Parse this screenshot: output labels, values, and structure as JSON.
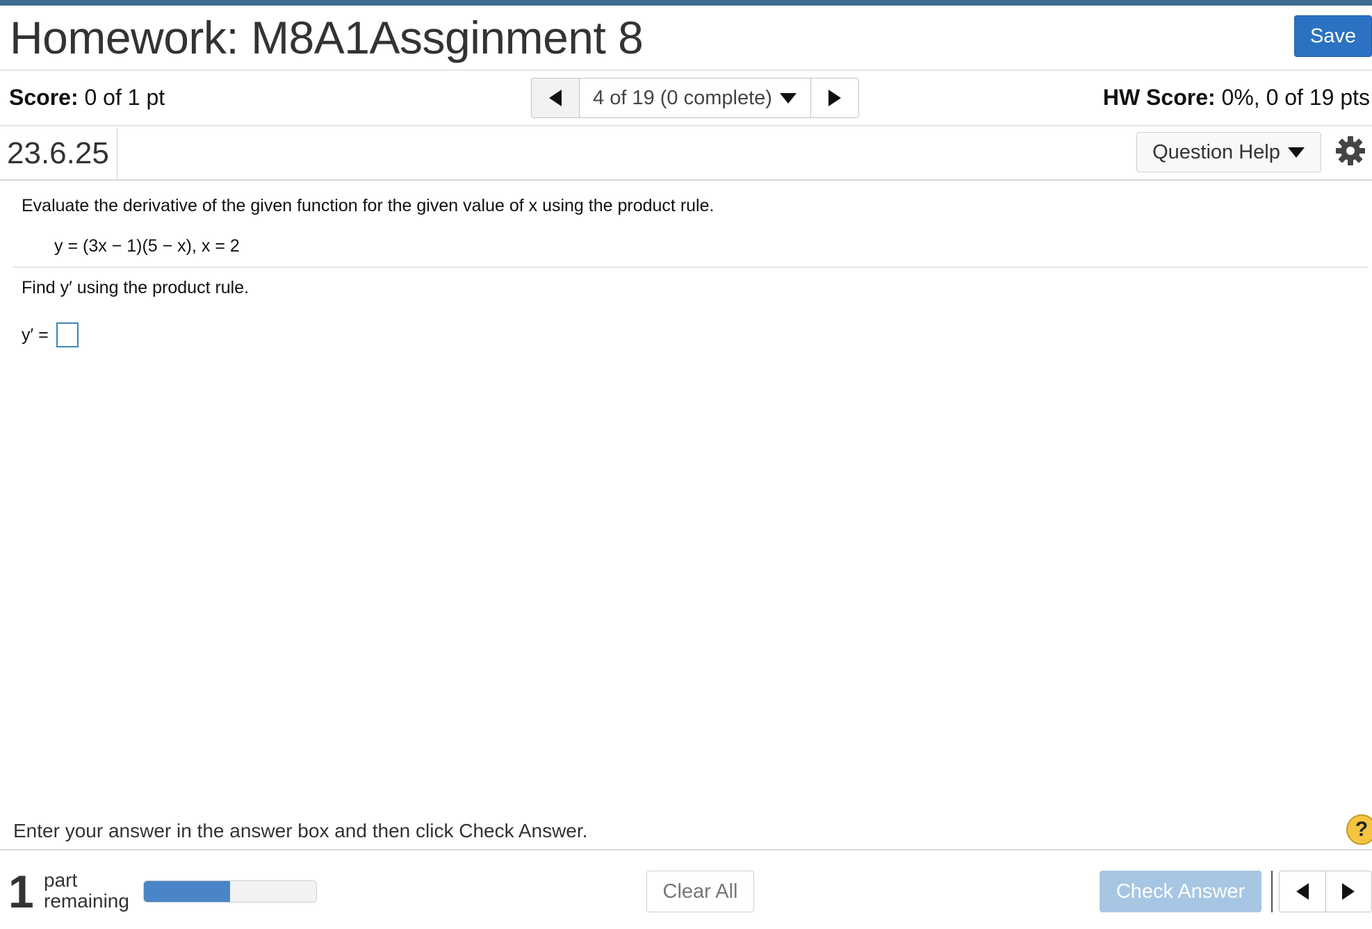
{
  "header": {
    "title": "Homework: M8A1Assginment 8",
    "save_label": "Save"
  },
  "score_bar": {
    "score_label": "Score:",
    "score_value": " 0 of 1 pt",
    "nav_text": "4 of 19 (0 complete)",
    "hw_score_label": "HW Score:",
    "hw_score_value": " 0%, 0 of 19 pts"
  },
  "question_bar": {
    "question_id": "23.6.25",
    "help_label": "Question Help"
  },
  "question": {
    "prompt": "Evaluate the derivative of the given function for the given value of x using the product rule.",
    "equation": "y = (3x − 1)(5 − x), x = 2",
    "find_text": "Find y′ using the product rule.",
    "answer_label": "y′ =",
    "answer_value": ""
  },
  "footer": {
    "instructions": "Enter your answer in the answer box and then click Check Answer.",
    "help_glyph": "?",
    "parts_count": "1",
    "parts_line1": "part",
    "parts_line2": "remaining",
    "progress_fraction": 0.5,
    "clear_label": "Clear All",
    "check_label": "Check Answer"
  },
  "colors": {
    "accent": "#2b72c2",
    "topbar": "#3a6d8f",
    "progress": "#4a86c7",
    "check_disabled": "#a7c6e3"
  }
}
